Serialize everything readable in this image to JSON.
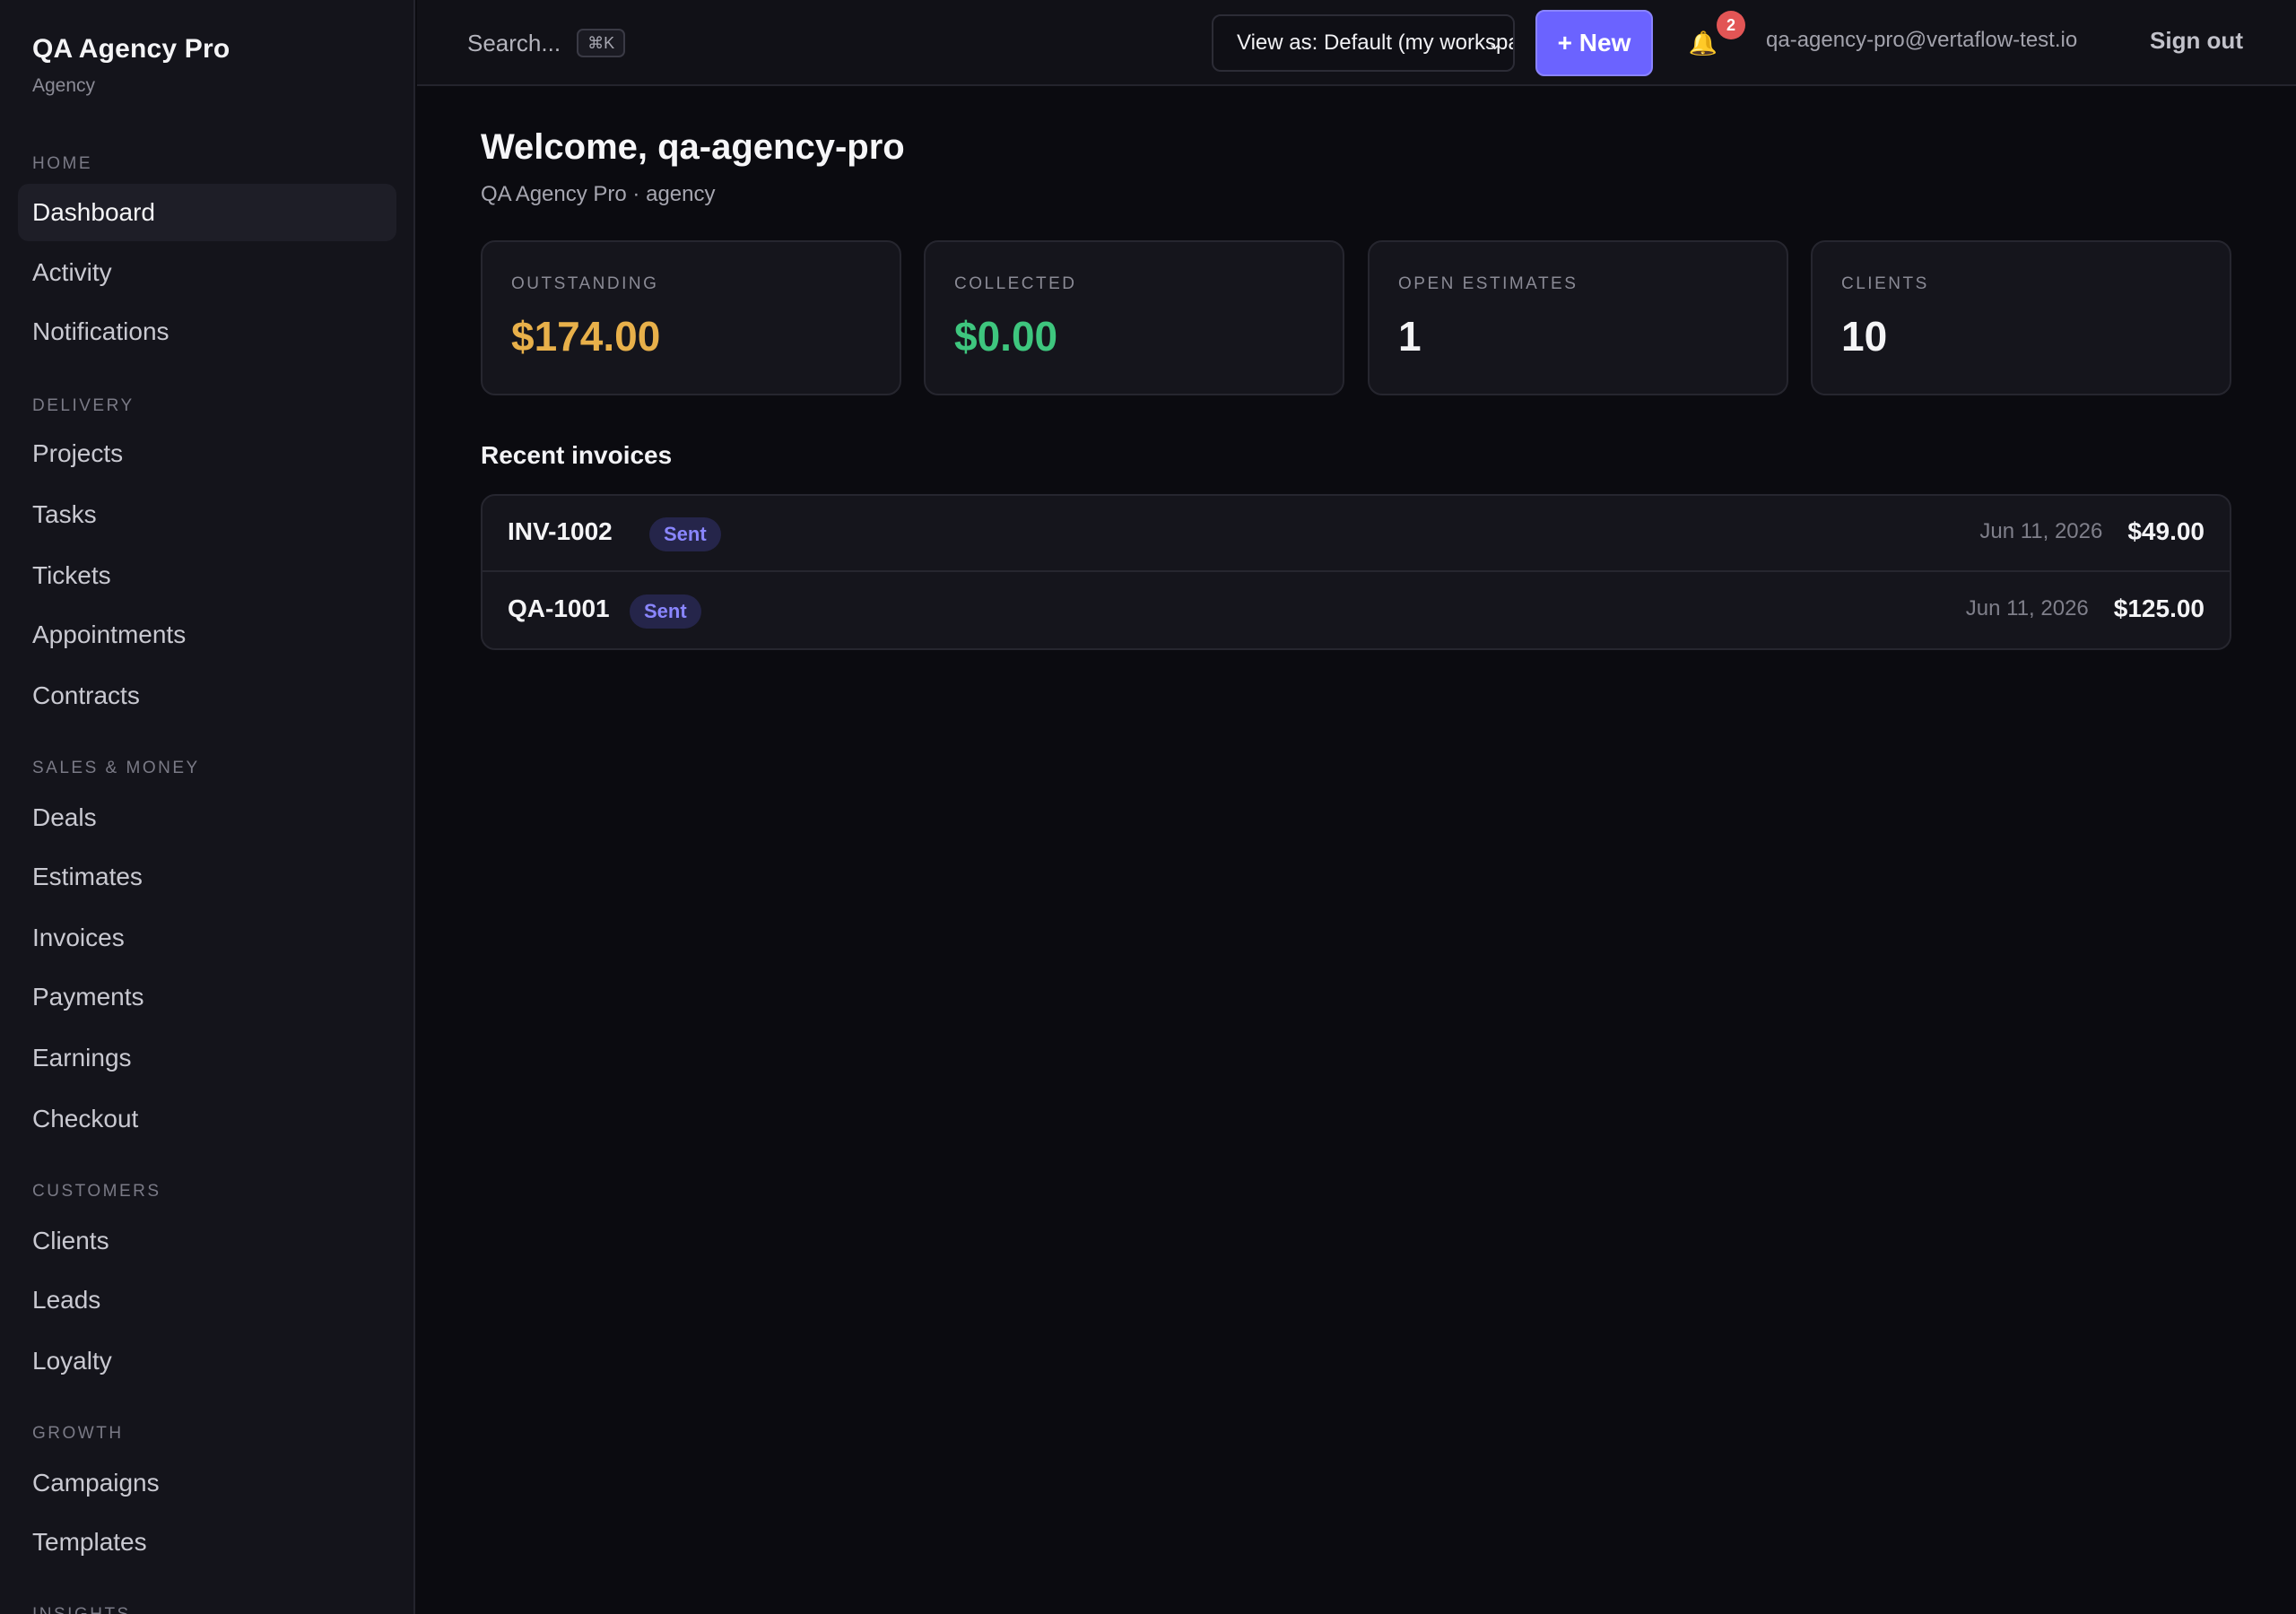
{
  "app": {
    "name": "QA Agency Pro",
    "subtitle": "Agency"
  },
  "sidebar": {
    "sections": [
      {
        "title": "HOME",
        "items": [
          "Dashboard",
          "Activity",
          "Notifications"
        ]
      },
      {
        "title": "DELIVERY",
        "items": [
          "Projects",
          "Tasks",
          "Tickets",
          "Appointments",
          "Contracts"
        ]
      },
      {
        "title": "SALES & MONEY",
        "items": [
          "Deals",
          "Estimates",
          "Invoices",
          "Payments",
          "Earnings",
          "Checkout"
        ]
      },
      {
        "title": "CUSTOMERS",
        "items": [
          "Clients",
          "Leads",
          "Loyalty"
        ]
      },
      {
        "title": "GROWTH",
        "items": [
          "Campaigns",
          "Templates"
        ]
      },
      {
        "title": "INSIGHTS",
        "items": []
      }
    ],
    "active": "Dashboard"
  },
  "topbar": {
    "search_label": "Search...",
    "search_shortcut": "⌘K",
    "view_as": "View as: Default (my workspace)",
    "new_label": "+ New",
    "notification_count": "2",
    "user_email": "qa-agency-pro@vertaflow-test.io",
    "sign_out": "Sign out"
  },
  "main": {
    "welcome": "Welcome, qa-agency-pro",
    "subtitle": "QA Agency Pro · agency",
    "stats": [
      {
        "label": "OUTSTANDING",
        "value": "$174.00",
        "color": "#e8b04a"
      },
      {
        "label": "COLLECTED",
        "value": "$0.00",
        "color": "#3ec67e"
      },
      {
        "label": "OPEN ESTIMATES",
        "value": "1",
        "color": "#f4f4f6"
      },
      {
        "label": "CLIENTS",
        "value": "10",
        "color": "#f4f4f6"
      }
    ],
    "recent_title": "Recent invoices",
    "invoices": [
      {
        "number": "INV-1002",
        "status": "Sent",
        "date": "Jun 11, 2026",
        "amount": "$49.00"
      },
      {
        "number": "QA-1001",
        "status": "Sent",
        "date": "Jun 11, 2026",
        "amount": "$125.00"
      }
    ]
  }
}
